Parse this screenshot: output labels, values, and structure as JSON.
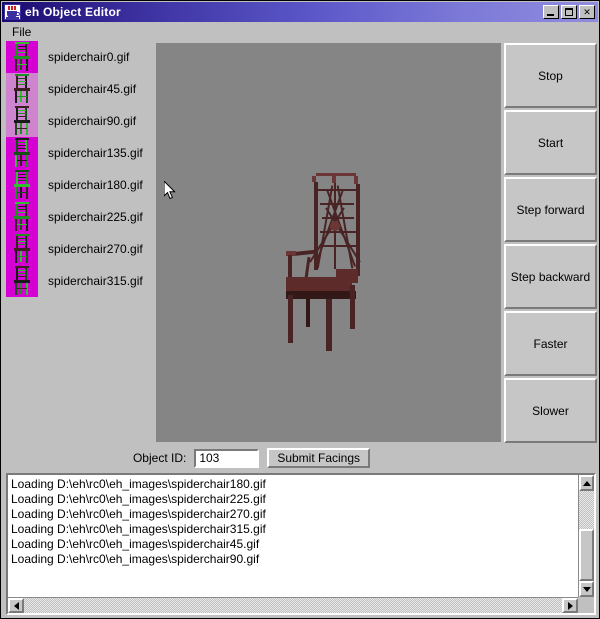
{
  "window": {
    "title": "eh Object Editor",
    "icon": "java-coffee-cup-icon",
    "controls": {
      "minimize": "_",
      "maximize": "□",
      "close": "✕"
    }
  },
  "menubar": {
    "items": [
      {
        "label": "File"
      }
    ]
  },
  "filelist": {
    "items": [
      {
        "label": "spiderchair0.gif",
        "thumb_bg": "magenta"
      },
      {
        "label": "spiderchair45.gif",
        "thumb_bg": "pink"
      },
      {
        "label": "spiderchair90.gif",
        "thumb_bg": "pink"
      },
      {
        "label": "spiderchair135.gif",
        "thumb_bg": "magenta"
      },
      {
        "label": "spiderchair180.gif",
        "thumb_bg": "magenta"
      },
      {
        "label": "spiderchair225.gif",
        "thumb_bg": "magenta"
      },
      {
        "label": "spiderchair270.gif",
        "thumb_bg": "magenta"
      },
      {
        "label": "spiderchair315.gif",
        "thumb_bg": "magenta"
      }
    ]
  },
  "canvas": {
    "background_color": "#858585",
    "subject": "spider-web-back-armchair",
    "chair_color": "#4a2424",
    "cursor": "arrow-pointer"
  },
  "controls": {
    "buttons": [
      {
        "label": "Stop"
      },
      {
        "label": "Start"
      },
      {
        "label": "Step forward"
      },
      {
        "label": "Step backward"
      },
      {
        "label": "Faster"
      },
      {
        "label": "Slower"
      }
    ]
  },
  "objectid": {
    "label": "Object ID:",
    "value": "103",
    "placeholder": "",
    "submit_label": "Submit Facings"
  },
  "log": {
    "lines": [
      "Loading D:\\eh\\rc0\\eh_images\\spiderchair180.gif",
      "Loading D:\\eh\\rc0\\eh_images\\spiderchair225.gif",
      "Loading D:\\eh\\rc0\\eh_images\\spiderchair270.gif",
      "Loading D:\\eh\\rc0\\eh_images\\spiderchair315.gif",
      "Loading D:\\eh\\rc0\\eh_images\\spiderchair45.gif",
      "Loading D:\\eh\\rc0\\eh_images\\spiderchair90.gif"
    ]
  }
}
